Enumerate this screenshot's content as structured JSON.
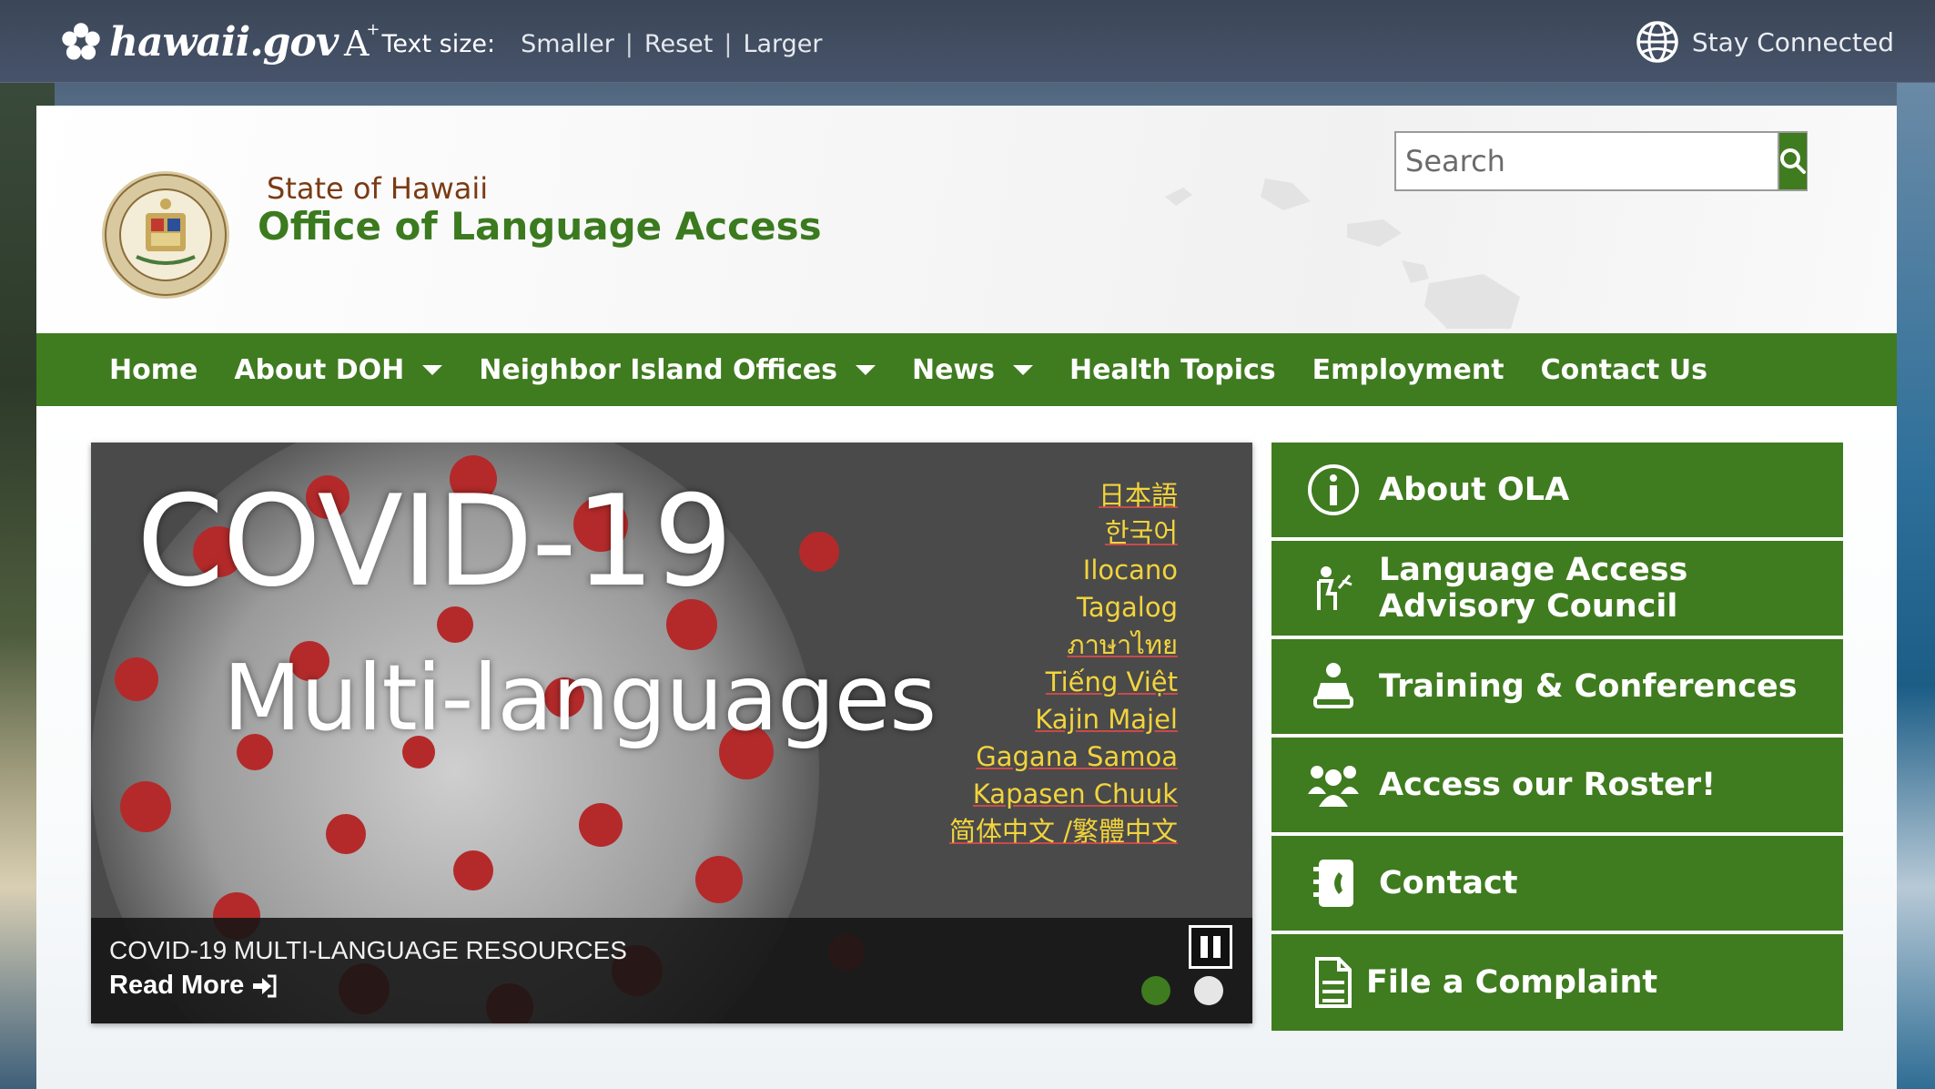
{
  "topbar": {
    "brand": "hawaii.gov",
    "text_size_label": "Text size:",
    "options": [
      "Smaller",
      "Reset",
      "Larger"
    ],
    "separator": "|",
    "stay_connected": "Stay Connected"
  },
  "header": {
    "title_small": "State of Hawaii",
    "title_big": "Office of Language Access",
    "search_placeholder": "Search"
  },
  "nav": {
    "items": [
      {
        "label": "Home",
        "dropdown": false
      },
      {
        "label": "About DOH",
        "dropdown": true
      },
      {
        "label": "Neighbor Island Offices",
        "dropdown": true
      },
      {
        "label": "News",
        "dropdown": true
      },
      {
        "label": "Health Topics",
        "dropdown": false
      },
      {
        "label": "Employment",
        "dropdown": false
      },
      {
        "label": "Contact Us",
        "dropdown": false
      }
    ]
  },
  "slider": {
    "headline": "COVID-19",
    "subhead": "Multi-languages",
    "languages": [
      "日本語",
      "한국어",
      "Ilocano",
      "Tagalog",
      "ภาษาไทย",
      "Tiếng Việt",
      "Kajin Majel",
      "Gagana Samoa",
      "Kapasen Chuuk",
      "简体中文 /繁體中文"
    ],
    "caption_title": "COVID-19 MULTI-LANGUAGE RESOURCES",
    "read_more": "Read More",
    "active_slide": 1,
    "slide_count": 2
  },
  "side": {
    "items": [
      {
        "label": "About OLA",
        "icon": "info-icon"
      },
      {
        "label_line1": "Language Access",
        "label_line2": "Advisory Council",
        "icon": "council-icon"
      },
      {
        "label": "Training & Conferences",
        "icon": "training-icon"
      },
      {
        "label": "Access our Roster!",
        "icon": "group-icon"
      },
      {
        "label": "Contact",
        "icon": "address-book-icon"
      },
      {
        "label": "File a Complaint",
        "icon": "document-icon"
      }
    ]
  },
  "colors": {
    "brand_green": "#3f7b1f",
    "title_brown": "#7a3b13",
    "language_yellow": "#f2d43c",
    "topbar": "#414c5f"
  }
}
